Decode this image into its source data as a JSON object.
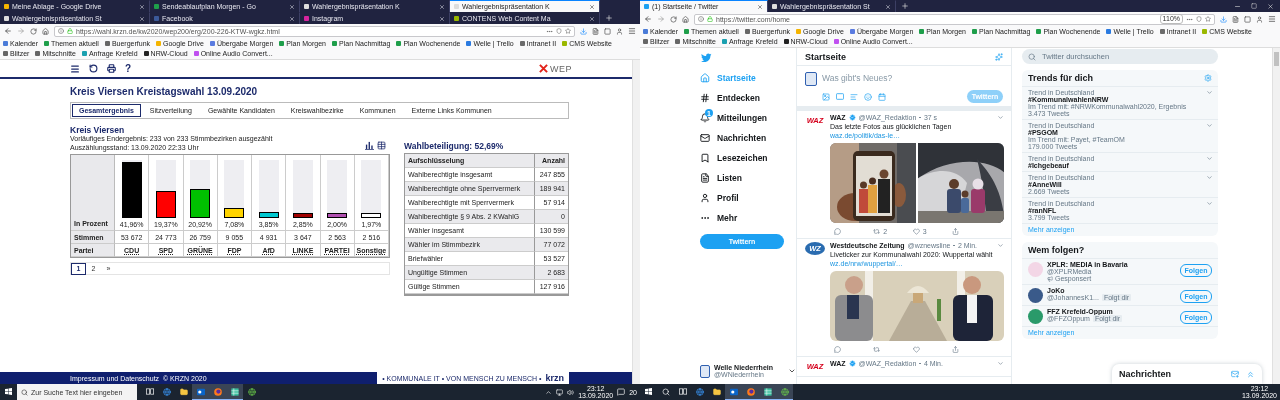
{
  "left_window": {
    "tabs": [
      {
        "title": "Meine Ablage - Google Drive",
        "selected": false
      },
      {
        "title": "Sendeablaufplan Morgen - Go",
        "selected": false
      },
      {
        "title": "Wahlergebnispräsentation K",
        "selected": false
      },
      {
        "title": "Wahlergebnispräsentation K",
        "selected": true
      },
      {
        "title": "Wahlergebnispräsentation St",
        "selected": false
      },
      {
        "title": "Facebook",
        "selected": false
      },
      {
        "title": "Instagram",
        "selected": false
      },
      {
        "title": "CONTENS Web Content Ma",
        "selected": false
      }
    ],
    "url": "https://wahl.krzn.de/kw2020/wep200/erg/200-226-KTW-wgkz.html",
    "bookmarks": [
      "Kalender",
      "Themen aktuell",
      "Buergerfunk",
      "Google Drive",
      "Übergabe Morgen",
      "Plan Morgen",
      "Plan Nachmittag",
      "Plan Wochenende",
      "Welle | Trello",
      "Intranet II",
      "CMS Website",
      "Blitzer",
      "Mitschnitte",
      "Anfrage Krefeld",
      "NRW-Cloud",
      "Online Audio Convert..."
    ],
    "page": {
      "logo": "WEP",
      "help": "?",
      "title": "Kreis Viersen Kreistagswahl 13.09.2020",
      "tabs": [
        {
          "label": "Gesamtergebnis",
          "selected": true
        },
        {
          "label": "Sitzverteilung",
          "selected": false
        },
        {
          "label": "Gewählte Kandidaten",
          "selected": false
        },
        {
          "label": "Kreiswahlbezirke",
          "selected": false
        },
        {
          "label": "Kommunen",
          "selected": false
        },
        {
          "label": "Externe Links Kommunen",
          "selected": false
        }
      ],
      "region": "Kreis Viersen",
      "status_lines": [
        "Vorläufiges Endergebnis: 233 von 233 Stimmbezirken ausgezählt",
        "Auszählungsstand: 13.09.2020 22:33 Uhr"
      ],
      "row_labels": [
        "In Prozent",
        "Stimmen",
        "Partei"
      ],
      "parties": [
        {
          "name": "CDU",
          "percent": "41,96%",
          "votes": "53 672",
          "color": "#000000",
          "level": 0.95
        },
        {
          "name": "SPD",
          "percent": "19,37%",
          "votes": "24 773",
          "color": "#ff0000",
          "level": 0.44
        },
        {
          "name": "GRÜNE",
          "percent": "20,92%",
          "votes": "26 759",
          "color": "#00c000",
          "level": 0.48
        },
        {
          "name": "FDP",
          "percent": "7,08%",
          "votes": "9 055",
          "color": "#ffd400",
          "level": 0.16
        },
        {
          "name": "AfD",
          "percent": "3,85%",
          "votes": "4 931",
          "color": "#00c8d0",
          "level": 0.09
        },
        {
          "name": "LINKE",
          "percent": "2,85%",
          "votes": "3 647",
          "color": "#a00000",
          "level": 0.065
        },
        {
          "name": "PARTEI",
          "percent": "2,00%",
          "votes": "2 563",
          "color": "#b050b0",
          "level": 0.05
        },
        {
          "name": "Sonstige",
          "percent": "1,97%",
          "votes": "2 516",
          "color": "#ffffff",
          "level": 0.05
        }
      ],
      "pages": [
        {
          "label": "1",
          "selected": true
        },
        {
          "label": "2",
          "selected": false
        },
        {
          "label": "»",
          "selected": false
        }
      ],
      "turnout": "Wahlbeteiligung: 52,69%",
      "breakdown": {
        "columns": [
          "Aufschlüsselung",
          "Anzahl"
        ],
        "rows": [
          [
            "Wahlberechtigte insgesamt",
            "247 855"
          ],
          [
            "Wahlberechtigte ohne Sperrvermerk",
            "189 941"
          ],
          [
            "Wahlberechtigte mit Sperrvermerk",
            "57 914"
          ],
          [
            "Wahlberechtigte § 9 Abs. 2 KWahlG",
            "0"
          ],
          [
            "Wähler insgesamt",
            "130 599"
          ],
          [
            "Wähler im Stimmbezirk",
            "77 072"
          ],
          [
            "Briefwähler",
            "53 527"
          ],
          [
            "Ungültige Stimmen",
            "2 683"
          ],
          [
            "Gültige Stimmen",
            "127 916"
          ]
        ]
      },
      "footer": "Impressum und Datenschutz  © KRZN 2020",
      "footer_logo": {
        "tagline": "• KOMMUNALE IT • VON MENSCH ZU MENSCH •",
        "name": "krzn"
      }
    },
    "taskbar": {
      "search_placeholder": "Zur Suche Text hier eingeben",
      "time": "23:12",
      "date": "13.09.2020",
      "notifications": "20"
    }
  },
  "right_window": {
    "tabs": [
      {
        "title": "(1) Startseite / Twitter",
        "selected": true
      },
      {
        "title": "Wahlergebnispräsentation St",
        "selected": false
      }
    ],
    "url": "https://twitter.com/home",
    "zoom": "110%",
    "bookmarks": [
      "Kalender",
      "Themen aktuell",
      "Buergerfunk",
      "Google Drive",
      "Übergabe Morgen",
      "Plan Morgen",
      "Plan Nachmittag",
      "Plan Wochenende",
      "Welle | Trello",
      "Intranet II",
      "CMS Website",
      "Blitzer",
      "Mitschnitte",
      "Anfrage Krefeld",
      "NRW-Cloud",
      "Online Audio Convert..."
    ],
    "twitter": {
      "nav": [
        {
          "kind": "home",
          "label": "Startseite",
          "selected": true
        },
        {
          "kind": "explore",
          "label": "Entdecken",
          "selected": false
        },
        {
          "kind": "notifications",
          "label": "Mitteilungen",
          "selected": false,
          "badge": "1"
        },
        {
          "kind": "messages",
          "label": "Nachrichten",
          "selected": false
        },
        {
          "kind": "bookmarks",
          "label": "Lesezeichen",
          "selected": false
        },
        {
          "kind": "lists",
          "label": "Listen",
          "selected": false
        },
        {
          "kind": "profile",
          "label": "Profil",
          "selected": false
        },
        {
          "kind": "more",
          "label": "Mehr",
          "selected": false
        }
      ],
      "tweet_button": "Twittern",
      "account": {
        "name": "Welle Niederrhein",
        "handle": "@WNiederrhein"
      },
      "header": "Startseite",
      "compose": {
        "placeholder": "Was gibt's Neues?",
        "button": "Twittern"
      },
      "tweets": [
        {
          "avatar": {
            "kind": "red",
            "text": "WAZ"
          },
          "name": "WAZ",
          "verified": true,
          "handle": "@WAZ_Redaktion",
          "time": "37 s",
          "text": "Das letzte Fotos aus glücklichen Tagen",
          "link": "waz.de/politik/das-le…",
          "retweets": "2",
          "likes": "3"
        },
        {
          "avatar": {
            "kind": "round",
            "text": "WZ"
          },
          "name": "Westdeutsche Zeitung",
          "verified": false,
          "handle": "@wznewsline",
          "time": "2 Min.",
          "text": "Liveticker zur Kommunalwahl 2020: Wuppertal wählt",
          "link": "wz.de/nrw/wuppertal/…"
        },
        {
          "avatar": {
            "kind": "red",
            "text": "WAZ"
          },
          "name": "WAZ",
          "verified": true,
          "handle": "@WAZ_Redaktion",
          "time": "4 Min."
        }
      ],
      "search_placeholder": "Twitter durchsuchen",
      "trends": {
        "title": "Trends für dich",
        "items": [
          {
            "context": "Trend in Deutschland",
            "name": "#KommunalwahlenNRW",
            "detail": "Im Trend mit: #NRWKommunalwahl2020, Ergebnis",
            "count": "3.473 Tweets"
          },
          {
            "context": "Trend in Deutschland",
            "name": "#PSGOM",
            "detail": "Im Trend mit: Payet, #TeamOM",
            "count": "179.000 Tweets"
          },
          {
            "context": "Trend in Deutschland",
            "name": "#Ichgebeauf"
          },
          {
            "context": "Trend in Deutschland",
            "name": "#AnneWill",
            "count": "2.669 Tweets"
          },
          {
            "context": "Trend in Deutschland",
            "name": "#ranNFL",
            "count": "3.799 Tweets"
          }
        ],
        "more": "Mehr anzeigen"
      },
      "follow": {
        "title": "Wem folgen?",
        "items": [
          {
            "name": "XPLR: MEDIA in Bavaria",
            "handle": "@XPLRMedia",
            "kind": "sponsored",
            "note": "Gesponsert",
            "button": "Folgen"
          },
          {
            "name": "JoKo",
            "handle": "@JohannesK1...",
            "kind": "follows",
            "note": "Folgt dir",
            "button": "Folgen"
          },
          {
            "name": "FFZ Krefeld-Oppum",
            "handle": "@FFZOppum",
            "kind": "follows",
            "note": "Folgt dir",
            "button": "Folgen"
          }
        ],
        "more": "Mehr anzeigen"
      },
      "messages_drawer": "Nachrichten"
    },
    "taskbar": {
      "time": "23:12",
      "date": "13.09.2020"
    }
  }
}
